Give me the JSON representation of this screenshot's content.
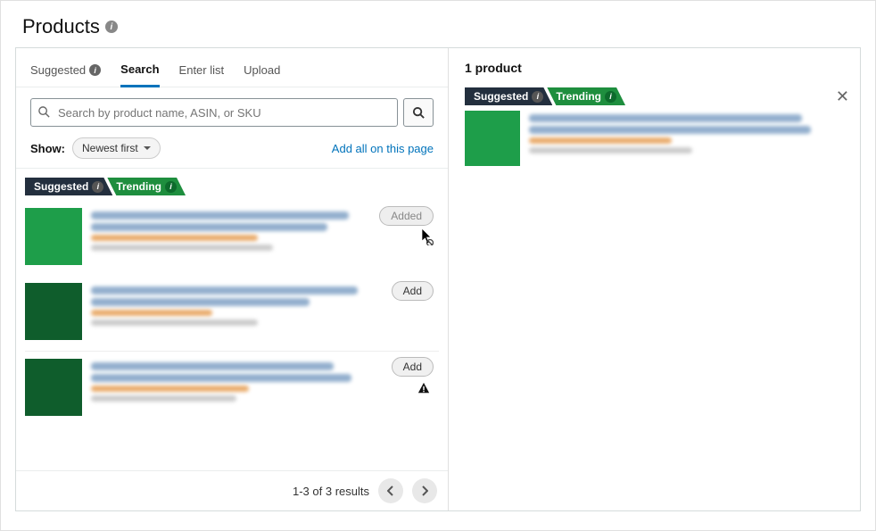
{
  "page": {
    "title": "Products"
  },
  "tabs": {
    "suggested": "Suggested",
    "search": "Search",
    "enter_list": "Enter list",
    "upload": "Upload"
  },
  "search": {
    "placeholder": "Search by product name, ASIN, or SKU"
  },
  "filter": {
    "show_label": "Show:",
    "sort_value": "Newest first",
    "add_all": "Add all on this page"
  },
  "badges": {
    "suggested": "Suggested",
    "trending": "Trending"
  },
  "buttons": {
    "added": "Added",
    "add": "Add"
  },
  "results": [
    {
      "thumb_color": "#1e9e4a",
      "state": "added",
      "show_badges": true,
      "show_warning": false
    },
    {
      "thumb_color": "#0f5d2c",
      "state": "add",
      "show_badges": false,
      "show_warning": false
    },
    {
      "thumb_color": "#0f5d2c",
      "state": "add",
      "show_badges": false,
      "show_warning": true
    }
  ],
  "footer": {
    "summary": "1-3 of 3 results"
  },
  "selection": {
    "count_label": "1 product",
    "item": {
      "thumb_color": "#1e9e4a"
    }
  }
}
